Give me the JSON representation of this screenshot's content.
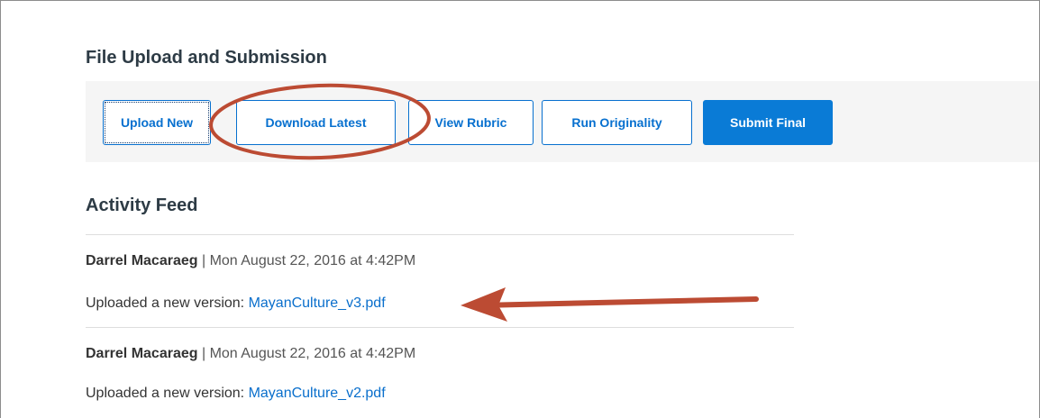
{
  "section": {
    "title": "File Upload and Submission"
  },
  "toolbar": {
    "buttons": [
      {
        "label": "Upload New"
      },
      {
        "label": "Download Latest"
      },
      {
        "label": "View Rubric"
      },
      {
        "label": "Run Originality"
      },
      {
        "label": "Submit Final"
      }
    ]
  },
  "feed": {
    "title": "Activity Feed",
    "separator": " | ",
    "entries": [
      {
        "author": "Darrel Macaraeg",
        "timestamp": "Mon August 22, 2016 at 4:42PM",
        "message": "Uploaded a new version: ",
        "file": "MayanCulture_v3.pdf"
      },
      {
        "author": "Darrel Macaraeg",
        "timestamp": "Mon August 22, 2016 at 4:42PM",
        "message": "Uploaded a new version: ",
        "file": "MayanCulture_v2.pdf"
      }
    ]
  },
  "annotation": {
    "color": "#bc4b33"
  }
}
